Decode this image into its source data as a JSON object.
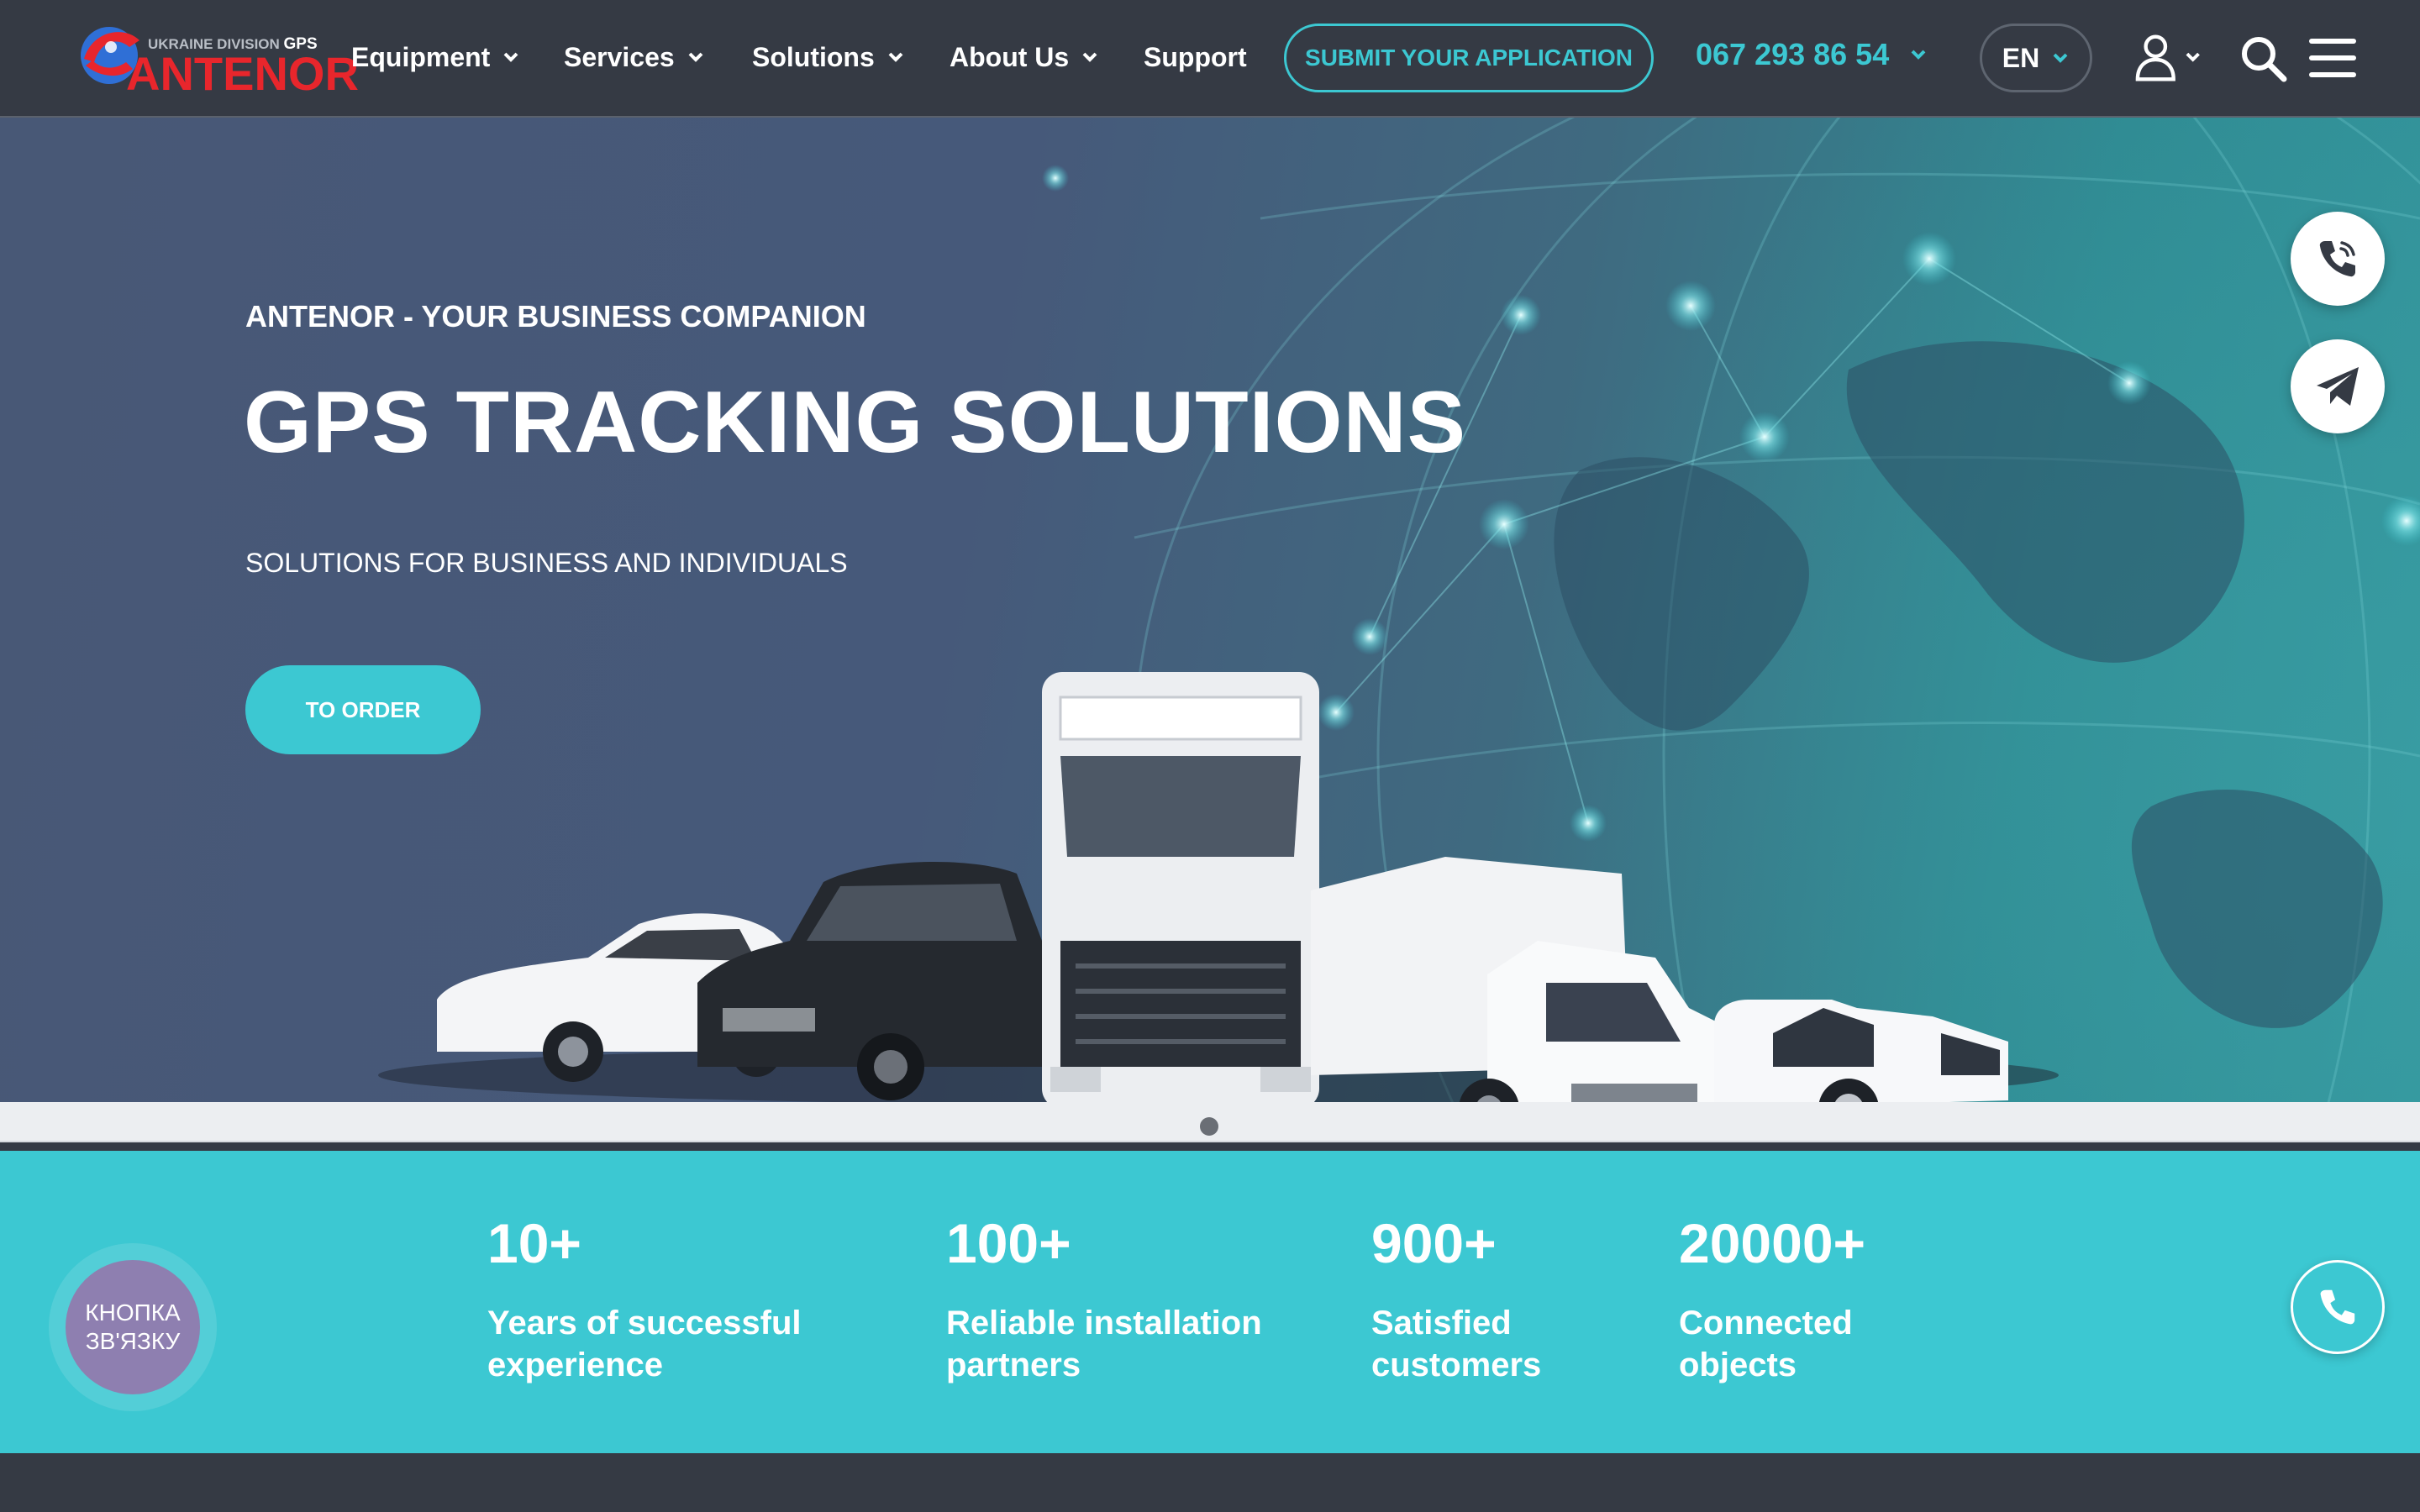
{
  "brand": {
    "subtitle": "UKRAINE DIVISION",
    "subtitle_bold": "GPS",
    "name": "ANTENOR",
    "accent_color": "#3cc8d2",
    "logo_red": "#e8262c"
  },
  "nav": {
    "items": [
      {
        "label": "Equipment",
        "has_dropdown": true
      },
      {
        "label": "Services",
        "has_dropdown": true
      },
      {
        "label": "Solutions",
        "has_dropdown": true
      },
      {
        "label": "About Us",
        "has_dropdown": true
      },
      {
        "label": "Support",
        "has_dropdown": false
      }
    ],
    "submit_label": "SUBMIT YOUR APPLICATION",
    "phone": "067 293 86 54",
    "language": "EN"
  },
  "hero": {
    "eyebrow": "ANTENOR - YOUR BUSINESS COMPANION",
    "title": "GPS TRACKING SOLUTIONS",
    "subtitle": "SOLUTIONS FOR BUSINESS AND INDIVIDUALS",
    "cta": "TO ORDER"
  },
  "slider": {
    "slides": 1,
    "active": 1
  },
  "stats": [
    {
      "value": "10",
      "suffix": "+",
      "label_line1": "Years of successful",
      "label_line2": "experience"
    },
    {
      "value": "100",
      "suffix": "+",
      "label_line1": "Reliable installation",
      "label_line2": "partners"
    },
    {
      "value": "900",
      "suffix": "+",
      "label_line1": "Satisfied",
      "label_line2": "customers"
    },
    {
      "value": "20000",
      "suffix": "+",
      "label_line1": "Connected",
      "label_line2": "objects"
    }
  ],
  "contact_widget": {
    "line1": "КНОПКА",
    "line2": "ЗВ'ЯЗКУ"
  },
  "icons": {
    "side_call": "phone-call-icon",
    "side_telegram": "telegram-icon",
    "fab": "phone-icon",
    "user": "user-icon",
    "search": "search-icon",
    "menu": "hamburger-menu-icon"
  }
}
